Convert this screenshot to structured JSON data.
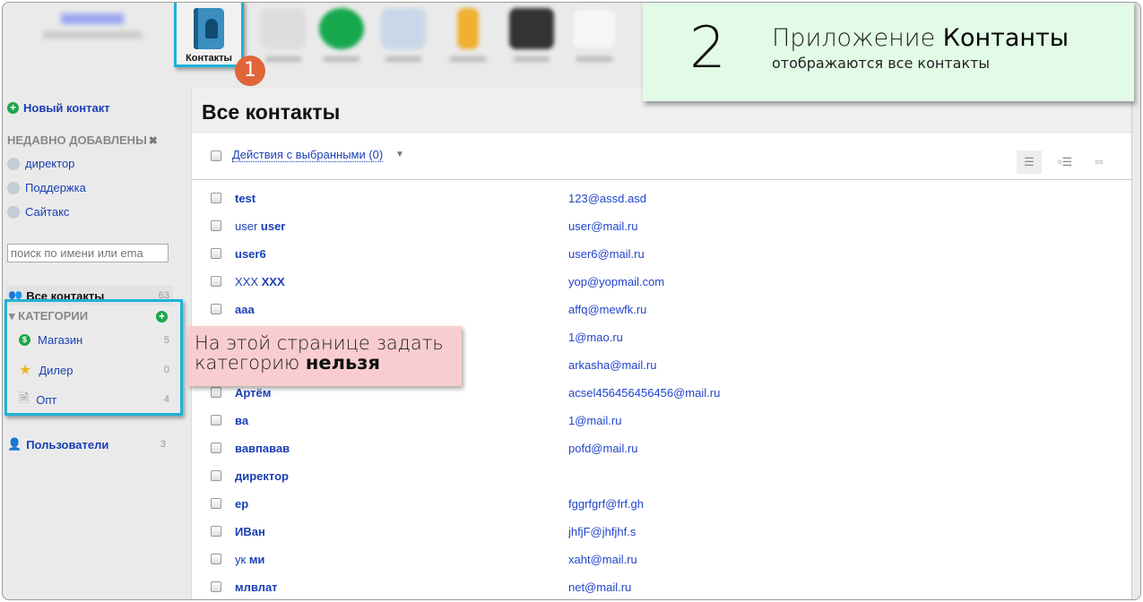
{
  "topbar": {
    "active_app_label": "Контакты",
    "step_badge": "1"
  },
  "callout_top": {
    "number": "2",
    "title_regular": "Приложение ",
    "title_bold": "Контанты",
    "subtitle": "отображаются все контакты"
  },
  "callout_side": {
    "line1": "На этой странице задать",
    "line2_regular": "категорию ",
    "line2_bold": "нельзя"
  },
  "sidebar": {
    "new_contact": "Новый контакт",
    "recent_header": "НЕДАВНО ДОБАВЛЕНЫ",
    "recent": [
      {
        "label": "директор",
        "icon": "person-icon"
      },
      {
        "label": "Поддержка",
        "icon": "person-icon"
      },
      {
        "label": "Сайтакс",
        "icon": "company-icon"
      }
    ],
    "search_placeholder": "поиск по имени или ema",
    "all_contacts": {
      "label": "Все контакты",
      "count": "63"
    },
    "categories_header": "КАТЕГОРИИ",
    "categories": [
      {
        "label": "Магазин",
        "count": "5",
        "icon": "dollar-icon"
      },
      {
        "label": "Дилер",
        "count": "0",
        "icon": "star-icon"
      },
      {
        "label": "Опт",
        "count": "4",
        "icon": "document-icon"
      }
    ],
    "users": {
      "label": "Пользователи",
      "count": "3"
    }
  },
  "main": {
    "title": "Все контакты",
    "actions_label": "Действия с выбранными (0)",
    "contacts": [
      {
        "first": "",
        "last": "test",
        "email": "123@assd.asd"
      },
      {
        "first": "user ",
        "last": "user",
        "email": "user@mail.ru"
      },
      {
        "first": "",
        "last": "user6",
        "email": "user6@mail.ru"
      },
      {
        "first": "XXX ",
        "last": "XXX",
        "email": "yop@yopmail.com"
      },
      {
        "first": "",
        "last": "aaa",
        "email": "affq@mewfk.ru"
      },
      {
        "first": "",
        "last": "",
        "email": "1@mao.ru"
      },
      {
        "first": "",
        "last": "",
        "email": "arkasha@mail.ru"
      },
      {
        "first": "",
        "last": "Артём",
        "email": "acsel456456456456@mail.ru"
      },
      {
        "first": "",
        "last": "ва",
        "email": "1@mail.ru"
      },
      {
        "first": "",
        "last": "вавпавав",
        "email": "pofd@mail.ru"
      },
      {
        "first": "",
        "last": "директор",
        "email": ""
      },
      {
        "first": "",
        "last": "ер",
        "email": "fggrfgrf@frf.gh"
      },
      {
        "first": "",
        "last": "ИВан",
        "email": "jhfjF@jhfjhf.s"
      },
      {
        "first": "ук ",
        "last": "ми",
        "email": "xaht@mail.ru"
      },
      {
        "first": "",
        "last": "млвлат",
        "email": "net@mail.ru"
      }
    ]
  },
  "colors": {
    "accent_link": "#1a3fb5",
    "highlight_border": "#1eb3d8",
    "step_badge": "#e0663a",
    "callout_green": "#e2fbe6",
    "callout_pink": "#f9cdcf"
  }
}
